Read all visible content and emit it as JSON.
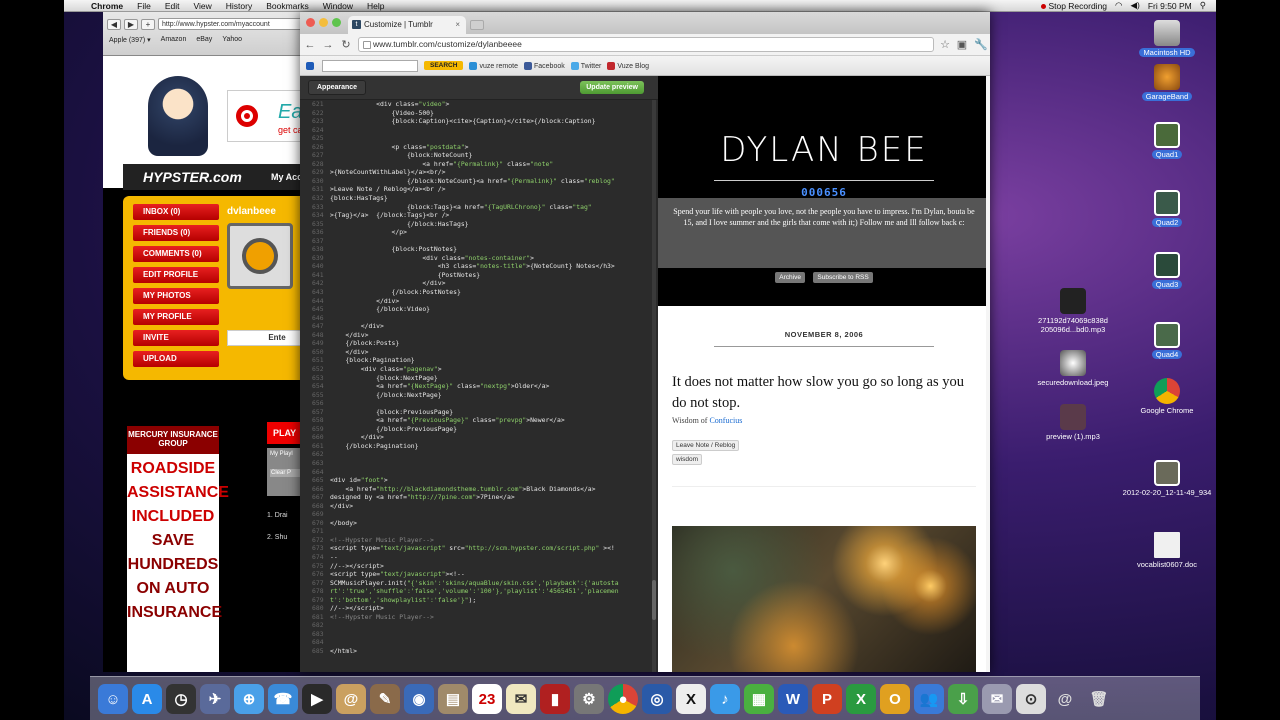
{
  "menubar": {
    "items": [
      "Chrome",
      "File",
      "Edit",
      "View",
      "History",
      "Bookmarks",
      "Window",
      "Help"
    ],
    "status": "Stop Recording",
    "clock": "Fri 9:50 PM"
  },
  "bg_browser": {
    "url": "http://www.hypster.com/myaccount",
    "bookmarks": [
      "Apple (397) ▾",
      "Amazon",
      "eBay",
      "Yahoo"
    ],
    "logo": "HYPSTER.com",
    "account_label": "My Acc",
    "target_text": "Ea",
    "target_sub": "get ca",
    "menu": [
      "INBOX (0)",
      "FRIENDS (0)",
      "COMMENTS (0)",
      "EDIT PROFILE",
      "MY PHOTOS",
      "MY PROFILE",
      "INVITE",
      "UPLOAD"
    ],
    "username": "dvlanbeee",
    "enter": "Ente",
    "ad_brand": "MERCURY INSURANCE GROUP",
    "ad_lines": [
      "ROADSIDE",
      "ASSISTANCE",
      "INCLUDED",
      "SAVE",
      "HUNDREDS",
      "ON AUTO",
      "INSURANCE"
    ],
    "play": "PLAY",
    "playlist_label": "My Playl",
    "clear": "Clear P",
    "pl_items": [
      "1. Drai",
      "2. Shu"
    ]
  },
  "browser": {
    "tab_title": "Customize | Tumblr",
    "url": "www.tumblr.com/customize/dylanbeeee",
    "toolbar": {
      "search_btn": "SEARCH",
      "vuze": "vuze remote",
      "facebook": "Facebook",
      "twitter": "Twitter",
      "vuze_blog": "Vuze Blog"
    }
  },
  "editor": {
    "appearance": "Appearance",
    "update": "Update preview"
  },
  "preview": {
    "blog_title": "DYLAN BEE",
    "counter": "000656",
    "bio": "Spend your life with people you love, not the people you have to impress. I'm Dylan, bouta be 15, and I love summer and the girls that come with it;) Follow me and Ill follow back c:",
    "links": [
      "Archive",
      "Subscribe to RSS"
    ],
    "post_date": "NOVEMBER 8, 2006",
    "quote": "It does not matter how slow you go so long as you do not stop.",
    "source_prefix": "Wisdom of",
    "source_name": "Confucius",
    "btn_leave": "Leave Note / Reblog",
    "tag": "wisdom"
  },
  "desktop_icons": [
    {
      "label": "Macintosh HD"
    },
    {
      "label": "GarageBand"
    },
    {
      "label": "Quad1"
    },
    {
      "label": "Quad2"
    },
    {
      "label": "Quad3"
    },
    {
      "label": "271192d74069c838d 205096d...bd0.mp3"
    },
    {
      "label": "Quad4"
    },
    {
      "label": "securedownload.jpeg"
    },
    {
      "label": "Google Chrome"
    },
    {
      "label": "preview (1).mp3"
    },
    {
      "label": "2012-02-20_12-11-49_934"
    },
    {
      "label": "vocablist0607.doc"
    }
  ],
  "dock_glyphs": [
    "☺",
    "A",
    "◷",
    "✈",
    "⊕",
    "☎",
    "▶",
    "@",
    "✎",
    "◉",
    "▤",
    "23",
    "✉",
    "▮",
    "⚙",
    "●",
    "◎",
    "X",
    "♪",
    "▦",
    "W",
    "P",
    "X",
    "O",
    "👥",
    "⇩",
    "✉",
    "⊙",
    "@",
    "🗑"
  ],
  "colors": {
    "red_btn": "#d40000",
    "hypster_yellow": "#f5b800",
    "editor_bg": "#2b2b2b",
    "update_green": "#5aa83c",
    "link_blue": "#1a6bd1"
  }
}
